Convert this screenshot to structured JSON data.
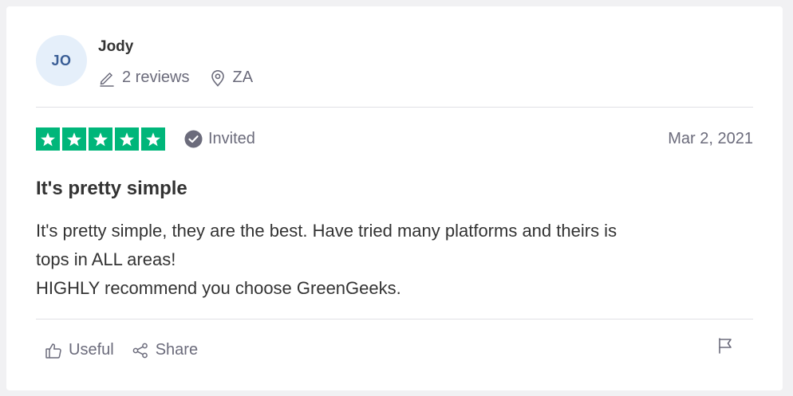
{
  "reviewer": {
    "initials": "JO",
    "name": "Jody",
    "reviews_count": "2 reviews",
    "country": "ZA",
    "pencil_icon": "pencil-icon",
    "location_icon": "location-pin-icon"
  },
  "review": {
    "rating": 5,
    "max_rating": 5,
    "star_color": "#00b67a",
    "invited_label": "Invited",
    "date": "Mar 2, 2021",
    "title": "It's pretty simple",
    "body_lines": [
      "It's pretty simple, they are the best. Have tried many platforms and theirs is",
      "tops in ALL areas!",
      "HIGHLY recommend you choose GreenGeeks."
    ]
  },
  "actions": {
    "useful_label": "Useful",
    "share_label": "Share",
    "useful_icon": "thumbs-up-icon",
    "share_icon": "share-icon",
    "flag_icon": "flag-icon"
  },
  "colors": {
    "avatar_bg": "#e5effa",
    "avatar_text": "#3a5e96",
    "muted_text": "#6b6b7b"
  }
}
